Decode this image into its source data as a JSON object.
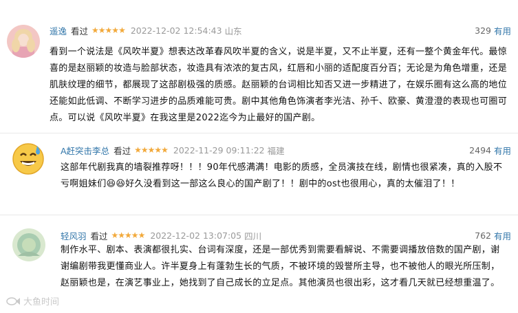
{
  "reviews": [
    {
      "user": "遥逸",
      "watched": "看过",
      "stars": "★★★★★",
      "time": "2022-12-02 12:54:43",
      "location": "山东",
      "helpful_count": "329",
      "helpful_label": "有用",
      "content": "看到一个说法是《风吹半夏》想表达改革春风吹半夏的含义，说是半夏，又不止半夏，还有一整个黄金年代。最惊喜的是赵丽颖的妆造与脸部状态，妆造具有浓浓的复古风，红唇和小丽的适配度百分百；无论是为角色增重，还是肌肤纹理的细节，都展现了这部剧极强的质感。赵丽颖的台词相比知否又进一步精进了，在娱乐圈有这么高的地位还能如此低调、不断学习进步的品质难能可贵。剧中其他角色饰演者李光洁、孙千、欧豪、黄澄澄的表现也可圈可点。可以说《风吹半夏》在我这里是2022迄今为止最好的国产剧。"
    },
    {
      "user": "A赶突击李总",
      "watched": "看过",
      "stars": "★★★★★",
      "time": "2022-11-29 09:11:22",
      "location": "福建",
      "helpful_count": "2494",
      "helpful_label": "有用",
      "content": "这部年代剧我真的墙裂推荐呀！！！90年代感满满！电影的质感，全员演技在线，剧情也很紧凑，真的入股不亏啊姐妹们😆😆好久没看到这一部这么良心的国产剧了！！剧中的ost也很用心，真的太催泪了！！"
    },
    {
      "user": "轻风羽",
      "watched": "看过",
      "stars": "★★★★★",
      "time": "2022-12-02 13:07:05",
      "location": "四川",
      "helpful_count": "762",
      "helpful_label": "有用",
      "content": "制作水平、剧本、表演都很扎实、台词有深度，还是一部优秀到需要看解说、不需要调播放倍数的国产剧，谢谢编剧带我更懂商业人。许半夏身上有蓬勃生长的气质，不被环境的毁誉所主导，也不被他人的眼光所压制，赵丽颖也是，在演艺事业上，她找到了自己成长的立足点。其他演员也很出彩，这才看几天就已经想重温了。"
    }
  ],
  "watermark": "大鱼时间",
  "colors": {
    "user": "#3377aa",
    "star": "#f2a93b",
    "meta": "#999999"
  }
}
